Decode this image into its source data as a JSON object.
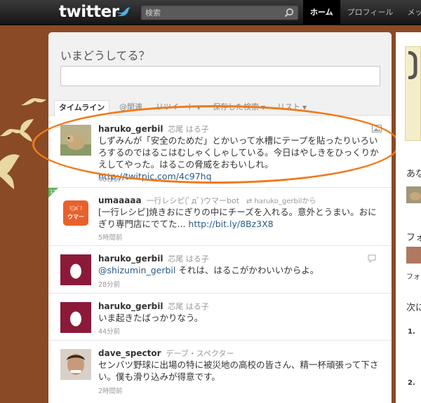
{
  "topbar": {
    "logo_text": "twitter",
    "search_placeholder": "検索",
    "nav": [
      "ホーム",
      "プロフィール",
      "メッセ"
    ]
  },
  "composer": {
    "title": "いまどうしてる？"
  },
  "tabs": [
    {
      "label": "タイムライン",
      "active": true
    },
    {
      "label": "@関連",
      "active": false
    },
    {
      "label": "リツイート",
      "active": false,
      "dropdown": true
    },
    {
      "label": "保存した検索",
      "active": false,
      "dropdown": true
    },
    {
      "label": "リスト",
      "active": false,
      "dropdown": true
    }
  ],
  "tweets": [
    {
      "username": "haruko_gerbil",
      "name": "芯尾 はる子",
      "text": "しずみんが「安全のためだ」とかいって水槽にテープを貼ったりいろいろするのではるこはむしゃくしゃしている。今日はやしきをひっくりかえしてやった。はるこの脅威をおもいしれ。",
      "link": "http://twitpic.com/4c97hq",
      "time": "40秒前",
      "highlighted": true
    },
    {
      "username": "umaaaaa",
      "name": "一行レシピ(ﾟдﾟ)ウマーbot",
      "retweeted_by": "haruko_gerbilから",
      "text": "[一行レシピ]焼きおにぎりの中にチーズを入れる。意外とうまい。おにぎり専門店にでてた...",
      "link": "http://bit.ly/8Bz3X8",
      "time": "5時間前",
      "avatar_text": "(ﾟдﾟ)",
      "avatar_sub": "ウマー"
    },
    {
      "username": "haruko_gerbil",
      "name": "芯尾 はる子",
      "mention": "@shizumin_gerbil",
      "text": " それは、はるこがかわいいからよ。",
      "time": "28分前"
    },
    {
      "username": "haruko_gerbil",
      "name": "芯尾 はる子",
      "text": "いま起きたばっかりなう。",
      "time": "44分前"
    },
    {
      "username": "dave_spector",
      "name": "デーブ・スペクター",
      "text": "センバツ野球に出場の特に被災地の高校の皆さん、精一杯頑張って下さい。僕も滑り込みが得意です。",
      "time": "2時間前"
    }
  ],
  "sidebar": {
    "texts": [
      "あな",
      "フォ",
      "フォロ",
      "次に",
      "1.",
      "2."
    ]
  },
  "colors": {
    "background": "#8a4a25",
    "link": "#2a5a8a",
    "highlight_ring": "#f07a1a",
    "egg_avatar": "#8b1a3a"
  }
}
